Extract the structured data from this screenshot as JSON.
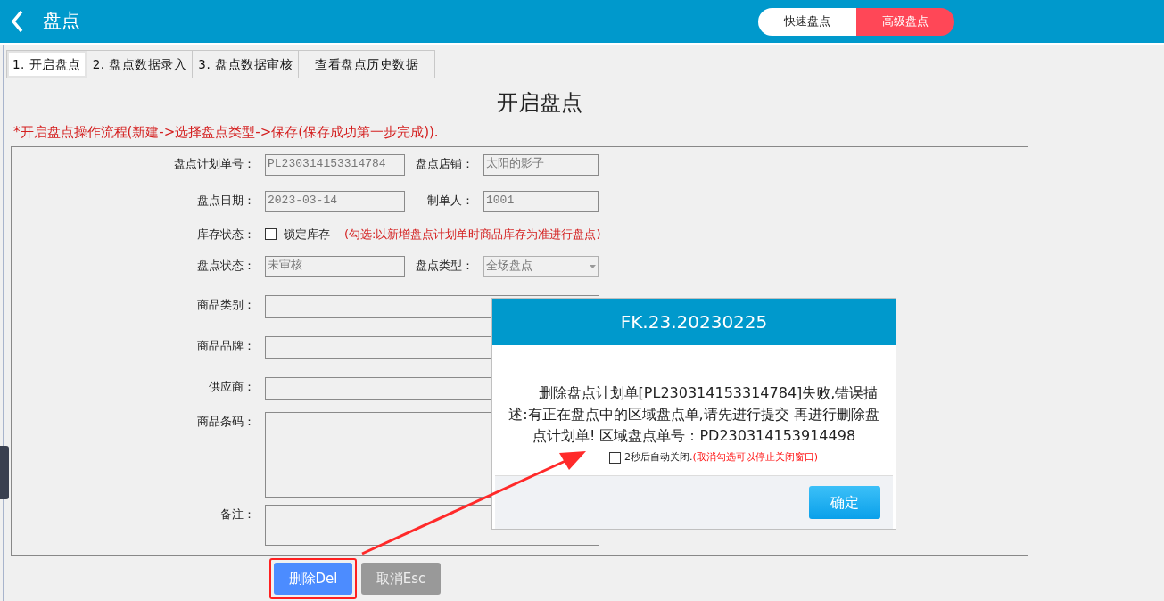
{
  "header": {
    "title": "盘点"
  },
  "mode_toggle": [
    {
      "label": "快速盘点",
      "selected": false
    },
    {
      "label": "高级盘点",
      "selected": true
    }
  ],
  "tabs": [
    {
      "label": "1. 开启盘点",
      "selected": true
    },
    {
      "label": "2. 盘点数据录入",
      "selected": false
    },
    {
      "label": "3. 盘点数据审核",
      "selected": false
    },
    {
      "label": "查看盘点历史数据",
      "selected": false
    }
  ],
  "page_title": "开启盘点",
  "instruction": "*开启盘点操作流程(新建->选择盘点类型->保存(保存成功第一步完成)).",
  "form": {
    "rows": [
      {
        "kind": "pair",
        "items": [
          {
            "kind": "text",
            "label": "盘点计划单号：",
            "value": "PL230314153314784"
          },
          {
            "kind": "text",
            "label": "盘点店铺：",
            "value": "太阳的影子"
          }
        ]
      },
      {
        "kind": "pair",
        "items": [
          {
            "kind": "text",
            "label": "盘点日期：",
            "value": "2023-03-14"
          },
          {
            "kind": "text",
            "label": "制单人：",
            "value": "1001"
          }
        ]
      },
      {
        "kind": "checkbox",
        "label": "库存状态：",
        "option": "锁定库存",
        "checked": false,
        "hint": "(勾选:以新增盘点计划单时商品库存为准进行盘点)"
      },
      {
        "kind": "pair",
        "items": [
          {
            "kind": "text",
            "label": "盘点状态：",
            "value": "未审核"
          },
          {
            "kind": "select",
            "label": "盘点类型：",
            "value": "全场盘点"
          }
        ]
      },
      {
        "kind": "wide",
        "label": "商品类别："
      },
      {
        "kind": "wide",
        "label": "商品品牌："
      },
      {
        "kind": "wide",
        "label": "供应商："
      },
      {
        "kind": "area",
        "label": "商品条码："
      },
      {
        "kind": "note",
        "label": "备注："
      }
    ]
  },
  "buttons": [
    {
      "label": "删除Del",
      "kind": "primary",
      "highlighted": true
    },
    {
      "label": "取消Esc",
      "kind": "secondary",
      "highlighted": false
    }
  ],
  "dialog": {
    "title": "FK.23.20230225",
    "message": "删除盘点计划单[PL230314153314784]失败,错误描述:有正在盘点中的区域盘点单,请先进行提交 再进行删除盘点计划单! 区域盘点单号：PD230314153914498",
    "auto_close": {
      "checked": false,
      "label": "2秒后自动关闭.",
      "hint": "(取消勾选可以停止关闭窗口)"
    },
    "ok_button": "确定"
  }
}
